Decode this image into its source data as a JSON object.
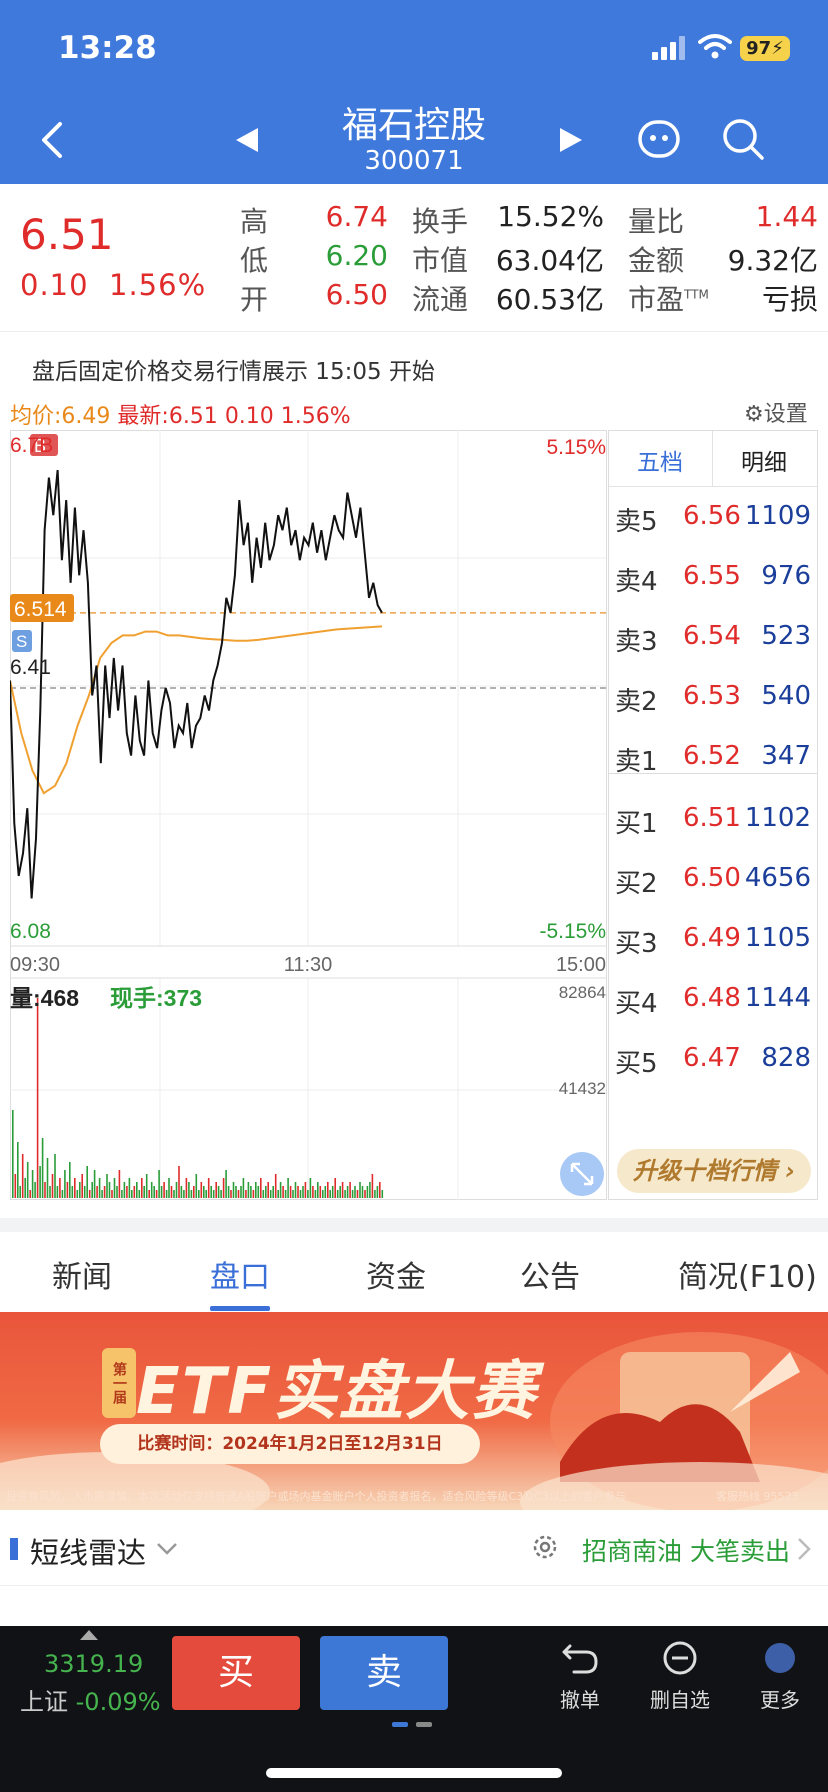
{
  "status_bar": {
    "time": "13:28",
    "battery": "97"
  },
  "header": {
    "name": "福石控股",
    "code": "300071"
  },
  "quote": {
    "price": "6.51",
    "change": "0.10",
    "change_pct": "1.56%",
    "stats": [
      {
        "label": "高",
        "value": "6.74",
        "color": "red"
      },
      {
        "label": "低",
        "value": "6.20",
        "color": "green"
      },
      {
        "label": "开",
        "value": "6.50",
        "color": "red"
      },
      {
        "label": "换手",
        "value": "15.52%"
      },
      {
        "label": "市值",
        "value": "63.04亿"
      },
      {
        "label": "流通",
        "value": "60.53亿"
      },
      {
        "label": "量比",
        "value": "1.44",
        "color": "red"
      },
      {
        "label": "金额",
        "value": "9.32亿"
      },
      {
        "label": "市盈",
        "sup": "TTM",
        "value": "亏损"
      }
    ]
  },
  "notice": "盘后固定价格交易行情展示 15:05 开始",
  "avg_bar": {
    "avg_label": "均价:6.49",
    "latest_label": "最新:6.51",
    "change": "0.10",
    "pct": "1.56%",
    "settings": "设置"
  },
  "chart_data": {
    "type": "line",
    "title": "",
    "y_max_label": "6.7B",
    "y_min_label": "6.08",
    "y_mid_label": "6.41",
    "pct_max": "5.15%",
    "pct_min": "-5.15%",
    "current_tag": "6.514",
    "marker_b": "B",
    "marker_s": "S",
    "x_ticks": [
      "09:30",
      "11:30",
      "15:00"
    ],
    "ylim": [
      6.08,
      6.74
    ],
    "prev_close": 6.41,
    "price_series": [
      6.42,
      6.23,
      6.16,
      6.19,
      6.25,
      6.13,
      6.21,
      6.38,
      6.62,
      6.69,
      6.64,
      6.7,
      6.58,
      6.66,
      6.55,
      6.65,
      6.56,
      6.62,
      6.55,
      6.4,
      6.44,
      6.31,
      6.44,
      6.37,
      6.45,
      6.38,
      6.44,
      6.35,
      6.32,
      6.4,
      6.34,
      6.32,
      6.42,
      6.35,
      6.33,
      6.38,
      6.41,
      6.39,
      6.33,
      6.36,
      6.35,
      6.39,
      6.33,
      6.36,
      6.37,
      6.4,
      6.38,
      6.42,
      6.44,
      6.47,
      6.53,
      6.51,
      6.56,
      6.66,
      6.6,
      6.63,
      6.55,
      6.61,
      6.57,
      6.63,
      6.58,
      6.6,
      6.64,
      6.62,
      6.65,
      6.6,
      6.62,
      6.58,
      6.61,
      6.6,
      6.63,
      6.59,
      6.62,
      6.58,
      6.61,
      6.64,
      6.62,
      6.61,
      6.67,
      6.64,
      6.61,
      6.65,
      6.59,
      6.53,
      6.55,
      6.52,
      6.51
    ],
    "avg_series": [
      6.42,
      6.35,
      6.3,
      6.27,
      6.28,
      6.31,
      6.36,
      6.4,
      6.45,
      6.47,
      6.48,
      6.48,
      6.485,
      6.485,
      6.48,
      6.48,
      6.478,
      6.476,
      6.475,
      6.474,
      6.473,
      6.473,
      6.474,
      6.476,
      6.478,
      6.48,
      6.482,
      6.484,
      6.486,
      6.488,
      6.489,
      6.49,
      6.491,
      6.492
    ],
    "volume_max_label": "82864",
    "volume_mid_label": "41432",
    "volume_label": "量:468",
    "hand_label": "现手:373",
    "volume_bars": [
      44,
      12,
      28,
      6,
      22,
      10,
      18,
      4,
      14,
      8,
      100,
      16,
      30,
      8,
      20,
      6,
      12,
      22,
      6,
      10,
      4,
      14,
      8,
      18,
      6,
      10,
      4,
      8,
      12,
      6,
      16,
      4,
      8,
      14,
      6,
      10,
      4,
      6,
      12,
      8,
      4,
      10,
      6,
      14,
      4,
      8,
      6,
      10,
      4,
      6,
      8,
      4,
      10,
      6,
      12,
      4,
      8,
      6,
      4,
      14,
      6,
      8,
      4,
      10,
      6,
      4,
      8,
      16,
      6,
      4,
      10,
      8,
      4,
      6,
      12,
      4,
      8,
      6,
      4,
      10,
      6,
      4,
      8,
      6,
      4,
      10,
      14,
      6,
      4,
      8,
      6,
      4,
      6,
      10,
      4,
      8,
      6,
      4,
      8,
      6,
      10,
      4,
      6,
      8,
      4,
      6,
      12,
      4,
      8,
      6,
      4,
      10,
      6,
      4,
      8,
      6,
      4,
      6,
      8,
      4,
      10,
      6,
      4,
      8,
      6,
      4,
      6,
      8,
      4,
      6,
      10,
      4,
      6,
      8,
      4,
      6,
      8,
      4,
      6,
      4,
      8,
      6,
      4,
      6,
      8,
      12,
      4,
      6,
      8,
      4
    ]
  },
  "order_book": {
    "tabs": [
      "五档",
      "明细"
    ],
    "sell": [
      {
        "label": "卖5",
        "price": "6.56",
        "vol": "1109"
      },
      {
        "label": "卖4",
        "price": "6.55",
        "vol": "976"
      },
      {
        "label": "卖3",
        "price": "6.54",
        "vol": "523"
      },
      {
        "label": "卖2",
        "price": "6.53",
        "vol": "540"
      },
      {
        "label": "卖1",
        "price": "6.52",
        "vol": "347"
      }
    ],
    "buy": [
      {
        "label": "买1",
        "price": "6.51",
        "vol": "1102"
      },
      {
        "label": "买2",
        "price": "6.50",
        "vol": "4656"
      },
      {
        "label": "买3",
        "price": "6.49",
        "vol": "1105"
      },
      {
        "label": "买4",
        "price": "6.48",
        "vol": "1144"
      },
      {
        "label": "买5",
        "price": "6.47",
        "vol": "828"
      }
    ],
    "upgrade": "升级十档行情"
  },
  "nav_tabs": [
    "新闻",
    "盘口",
    "资金",
    "公告",
    "简况(F10)"
  ],
  "banner": {
    "badge": "第一届",
    "title": "ETF实盘大赛",
    "date": "比赛时间：2024年1月2日至12月31日",
    "note": "投资有风险，入市需谨慎。本次活动仅支持普通A股账户或场内基金账户个人投资者报名，适合风险等级C3及C3以上的客户参与",
    "hotline": "客服热线 95523"
  },
  "radar": {
    "title": "短线雷达",
    "info": "招商南油 大笔卖出"
  },
  "bottom": {
    "index_value": "3319.19",
    "index_name": "上证",
    "index_change": "-0.09%",
    "buy": "买",
    "sell": "卖",
    "actions": [
      "撤单",
      "删自选",
      "更多"
    ]
  },
  "colors": {
    "header": "#4079dc",
    "red": "#e02b2b",
    "green": "#2a9d38",
    "orange": "#e8891a",
    "blue_accent": "#3a6fd8"
  }
}
